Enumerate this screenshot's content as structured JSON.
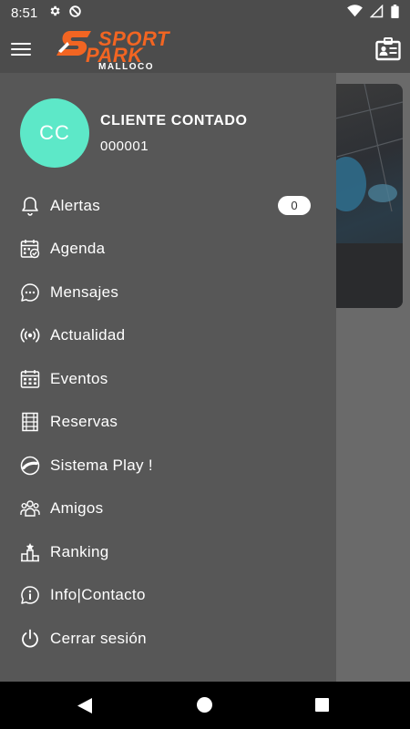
{
  "status_bar": {
    "time": "8:51",
    "icons": [
      "gear-icon",
      "data-saver-icon",
      "wifi-icon",
      "signal-icon",
      "battery-icon"
    ]
  },
  "app_bar": {
    "logo": {
      "line1": "SPORT",
      "line2": "PARK",
      "line3": "MALLOCO"
    },
    "icons": [
      "menu-icon",
      "id-card-icon"
    ]
  },
  "profile": {
    "initials": "CC",
    "name": "CLIENTE CONTADO",
    "id": "000001",
    "avatar_color": "#5de8c8"
  },
  "menu": {
    "items": [
      {
        "label": "Alertas",
        "icon": "bell-icon",
        "badge": "0"
      },
      {
        "label": "Agenda",
        "icon": "calendar-check-icon"
      },
      {
        "label": "Mensajes",
        "icon": "chat-icon"
      },
      {
        "label": "Actualidad",
        "icon": "broadcast-icon"
      },
      {
        "label": "Eventos",
        "icon": "calendar-grid-icon"
      },
      {
        "label": "Reservas",
        "icon": "court-icon"
      },
      {
        "label": "Sistema Play !",
        "icon": "play-badge-icon"
      },
      {
        "label": "Amigos",
        "icon": "group-icon"
      },
      {
        "label": "Ranking",
        "icon": "podium-icon"
      },
      {
        "label": "Info|Contacto",
        "icon": "info-icon"
      },
      {
        "label": "Cerrar sesión",
        "icon": "power-icon"
      }
    ]
  },
  "colors": {
    "brand_orange": "#f26522",
    "drawer_bg": "#575757",
    "appbar_bg": "#4c4c4c"
  },
  "nav_bar": {
    "icons": [
      "back-icon",
      "home-icon",
      "recents-icon"
    ]
  }
}
